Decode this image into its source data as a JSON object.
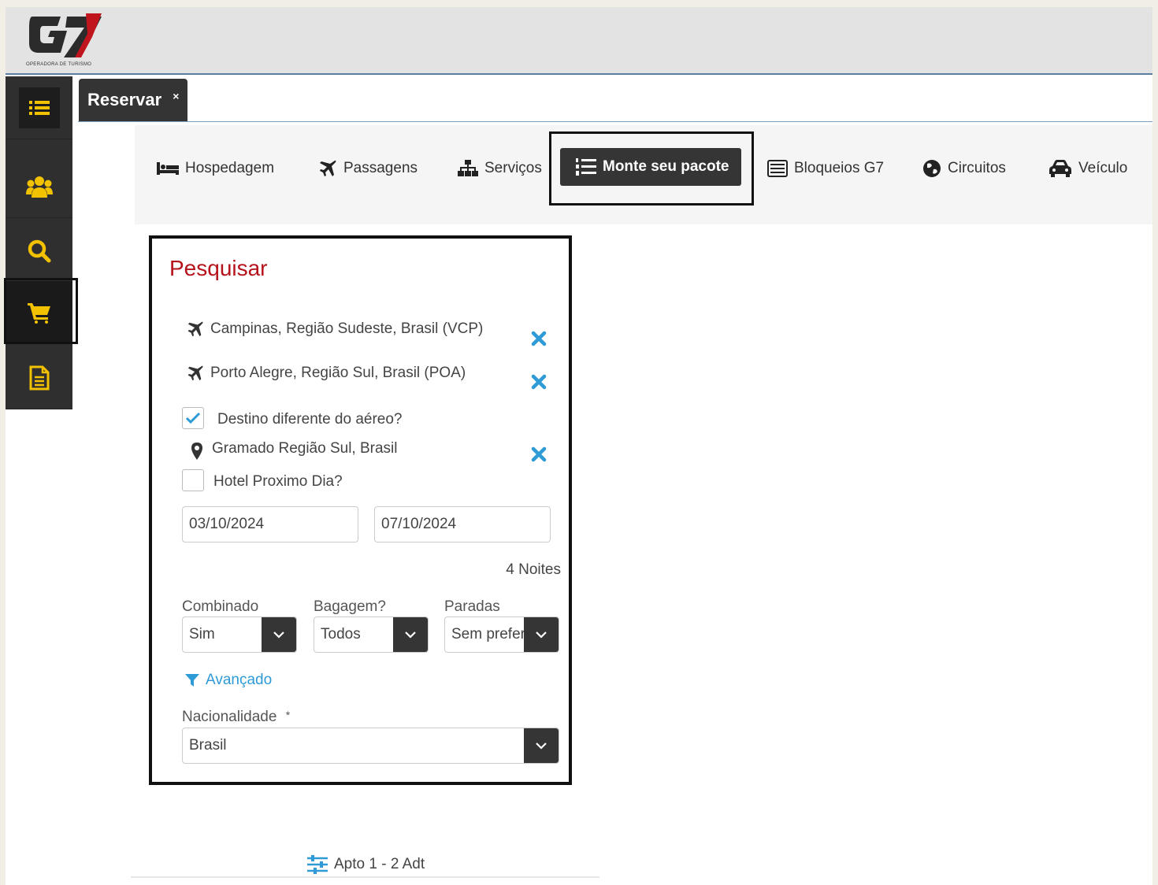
{
  "brand": {
    "logo_text": "G7",
    "tagline": "OPERADORA DE TURISMO",
    "accent": "#f2c200",
    "title_red": "#b5121b",
    "link_blue": "#2e9ad6"
  },
  "sidebar": {
    "items": [
      {
        "name": "menu",
        "icon": "list-icon"
      },
      {
        "name": "clients",
        "icon": "users-icon"
      },
      {
        "name": "search",
        "icon": "search-icon"
      },
      {
        "name": "cart",
        "icon": "cart-icon"
      },
      {
        "name": "documents",
        "icon": "document-icon"
      }
    ]
  },
  "tabs": [
    {
      "label": "Reservar",
      "close": "×"
    }
  ],
  "nav": {
    "items": [
      {
        "label": "Hospedagem",
        "icon": "bed-icon"
      },
      {
        "label": "Passagens",
        "icon": "plane-icon"
      },
      {
        "label": "Serviços",
        "icon": "sitemap-icon"
      },
      {
        "label": "Monte seu pacote",
        "icon": "list-ol-icon",
        "active": true
      },
      {
        "label": "Bloqueios G7",
        "icon": "list-alt-icon"
      },
      {
        "label": "Circuitos",
        "icon": "globe-icon"
      },
      {
        "label": "Veículo",
        "icon": "car-icon"
      }
    ]
  },
  "search": {
    "title": "Pesquisar",
    "origin": "Campinas, Região Sudeste, Brasil (VCP)",
    "destination": "Porto Alegre, Região Sul, Brasil (POA)",
    "different_destination_label": "Destino diferente do aéreo?",
    "different_destination_checked": true,
    "hotel_destination": "Gramado Região Sul, Brasil",
    "hotel_next_day_label": "Hotel Proximo Dia?",
    "hotel_next_day_checked": false,
    "checkin": "03/10/2024",
    "checkout": "07/10/2024",
    "nights": "4 Noites",
    "combinado": {
      "label": "Combinado",
      "value": "Sim"
    },
    "bagagem": {
      "label": "Bagagem?",
      "value": "Todos"
    },
    "paradas": {
      "label": "Paradas",
      "value": "Sem preferência"
    },
    "advanced": "Avançado",
    "nationality": {
      "label": "Nacionalidade",
      "required": "*",
      "value": "Brasil"
    }
  },
  "rooms": {
    "summary": "Apto 1 - 2 Adt"
  }
}
